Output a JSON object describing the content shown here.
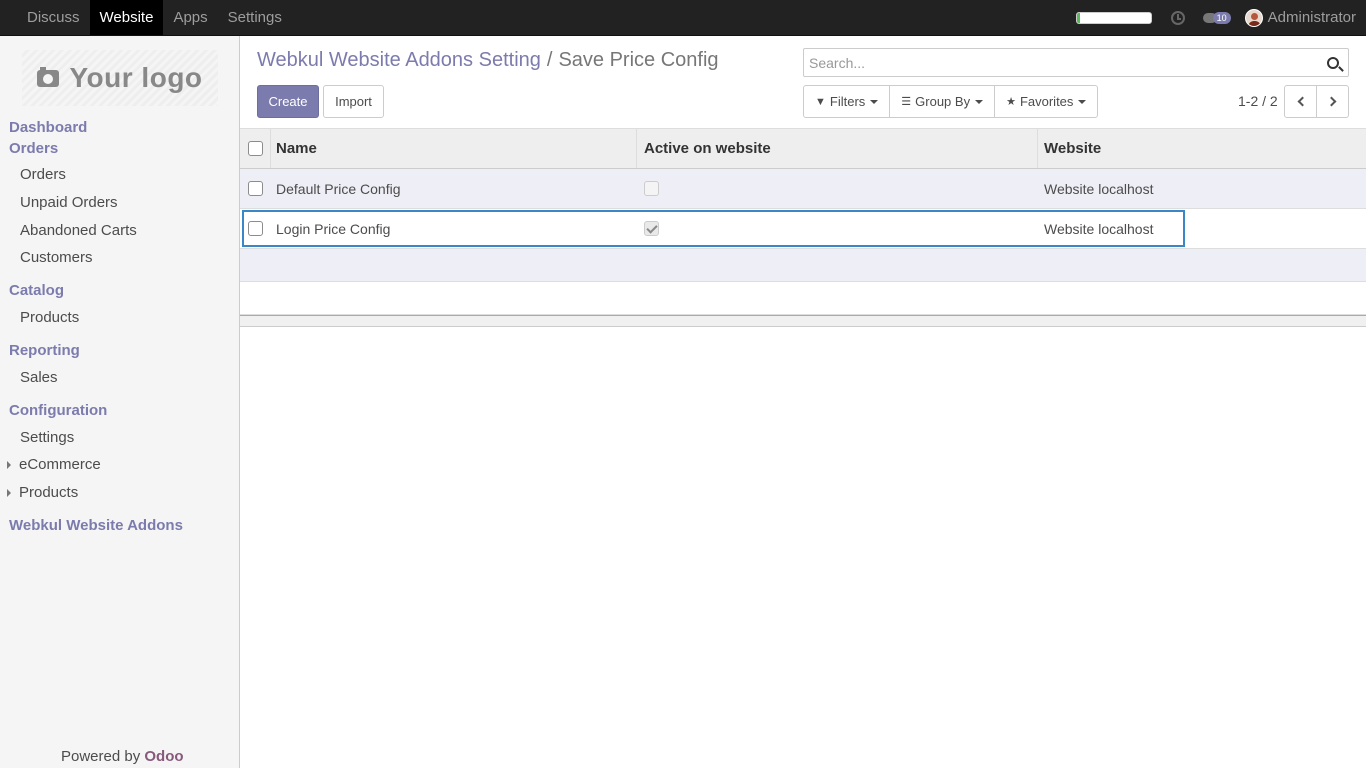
{
  "topbar": {
    "menu": [
      "Discuss",
      "Website",
      "Apps",
      "Settings"
    ],
    "active": "Website",
    "progress": 0.05,
    "message_count": "10",
    "user": "Administrator"
  },
  "sidebar": {
    "logo_text": "Your logo",
    "sections": [
      {
        "label": "Dashboard"
      },
      {
        "label": "Orders",
        "items": [
          "Orders",
          "Unpaid Orders",
          "Abandoned Carts",
          "Customers"
        ]
      },
      {
        "label": "Catalog",
        "items": [
          "Products"
        ]
      },
      {
        "label": "Reporting",
        "items": [
          "Sales"
        ]
      },
      {
        "label": "Configuration",
        "items": [
          "Settings"
        ],
        "expandable": [
          "eCommerce",
          "Products"
        ]
      },
      {
        "label": "Webkul Website Addons"
      }
    ],
    "powered_by": "Powered by",
    "powered_brand": "Odoo"
  },
  "control_panel": {
    "breadcrumb_parent": "Webkul Website Addons Setting",
    "breadcrumb_sep": "/",
    "breadcrumb_current": "Save Price Config",
    "create_label": "Create",
    "import_label": "Import",
    "search_placeholder": "Search...",
    "filters_label": "Filters",
    "groupby_label": "Group By",
    "favorites_label": "Favorites",
    "pager": "1-2 / 2"
  },
  "list": {
    "columns": [
      "Name",
      "Active on website",
      "Website"
    ],
    "rows": [
      {
        "name": "Default Price Config",
        "active": false,
        "website": "Website localhost"
      },
      {
        "name": "Login Price Config",
        "active": true,
        "website": "Website localhost"
      }
    ]
  },
  "colors": {
    "accent": "#7c7bad",
    "topbar": "#222222",
    "selection": "#3a87c8"
  }
}
